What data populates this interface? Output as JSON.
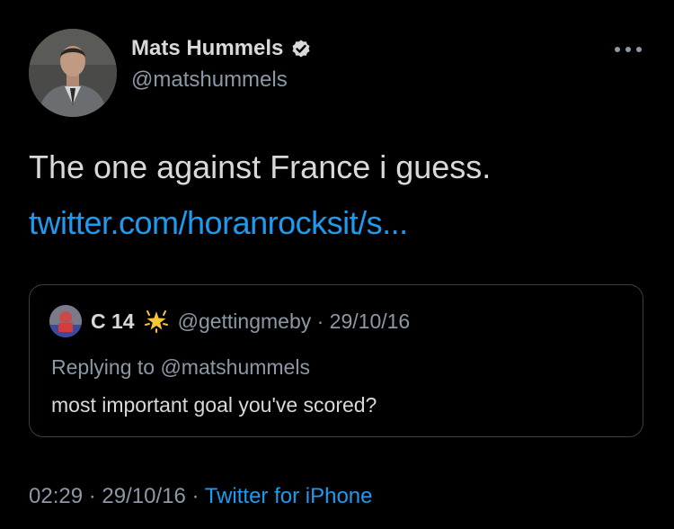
{
  "author": {
    "display_name": "Mats Hummels",
    "handle": "@matshummels",
    "verified": true,
    "avatar_icon": "profile-photo"
  },
  "tweet": {
    "text": "The one against France i guess.",
    "link": "twitter.com/horanrocksit/s..."
  },
  "quoted_tweet": {
    "display_name": "C 14",
    "emoji_icon": "glowing-star-icon",
    "handle_and_date": "@gettingmeby · 29/10/16",
    "replying_to": "Replying to @matshummels",
    "text": "most important goal you've scored?"
  },
  "footer": {
    "time": "02:29",
    "separator_1": "·",
    "date": "29/10/16",
    "separator_2": "·",
    "source": "Twitter for iPhone"
  },
  "colors": {
    "background": "#000000",
    "text": "#d9d9d9",
    "secondary": "#8b98a5",
    "accent": "#1d9bf0",
    "border": "#3a3f44"
  }
}
